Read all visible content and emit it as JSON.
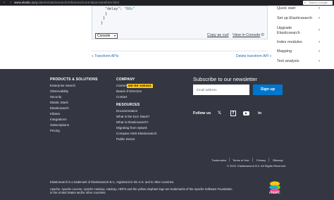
{
  "browser": {
    "url_host": "www.elastic.co",
    "url_path": "/guide/en/elasticsearch/reference/current/put-transform.html",
    "search_placeholder": "Search Google"
  },
  "console": {
    "code_lines": [
      "  \"delay\": \"60s\"",
      "  }",
      " }",
      "}"
    ],
    "select_value": "Console",
    "copy_curl": "Copy as curl",
    "view_console": "View in Console"
  },
  "pager": {
    "prev": "« Transform APIs",
    "next": "Delete transform API »"
  },
  "sidebar": {
    "items": [
      {
        "label": "Quick start"
      },
      {
        "label": "Set up Elasticsearch"
      },
      {
        "label": "Upgrade Elasticsearch"
      },
      {
        "label": "Index modules"
      },
      {
        "label": "Mapping"
      },
      {
        "label": "Text analysis"
      }
    ]
  },
  "footer": {
    "products_title": "PRODUCTS & SOLUTIONS",
    "products": [
      "Enterprise Search",
      "Observability",
      "Security",
      "Elastic Stack",
      "Elasticsearch",
      "Kibana",
      "Integrations",
      "Subscriptions",
      "Pricing"
    ],
    "company_title": "COMPANY",
    "company": [
      "Careers",
      "Board of Directors",
      "Contact"
    ],
    "hiring_badge": "WE'RE HIRING",
    "resources_title": "RESOURCES",
    "resources": [
      "Documentation",
      "What is the ELK Stack?",
      "What is Elasticsearch?",
      "Migrating from Splunk",
      "Compare AWS Elasticsearch",
      "Public Sector"
    ],
    "newsletter_title": "Subscribe to our newsletter",
    "email_placeholder": "Email address",
    "signup_label": "Sign up",
    "follow_label": "Follow us",
    "legal_links": [
      "Trademarks",
      "Terms of Use",
      "Privacy",
      "Sitemap"
    ],
    "copyright": "© 2022. Elasticsearch B.V. All Rights Reserved",
    "trademark_line1": "Elasticsearch is a trademark of Elasticsearch B.V., registered in the U.S. and in other countries.",
    "trademark_line2": "Apache, Apache Lucene, Apache Hadoop, Hadoop, HDFS and the yellow elephant logo are trademarks of the Apache Software Foundation in the United States and/or other countries.",
    "logo_text": "elastic"
  }
}
